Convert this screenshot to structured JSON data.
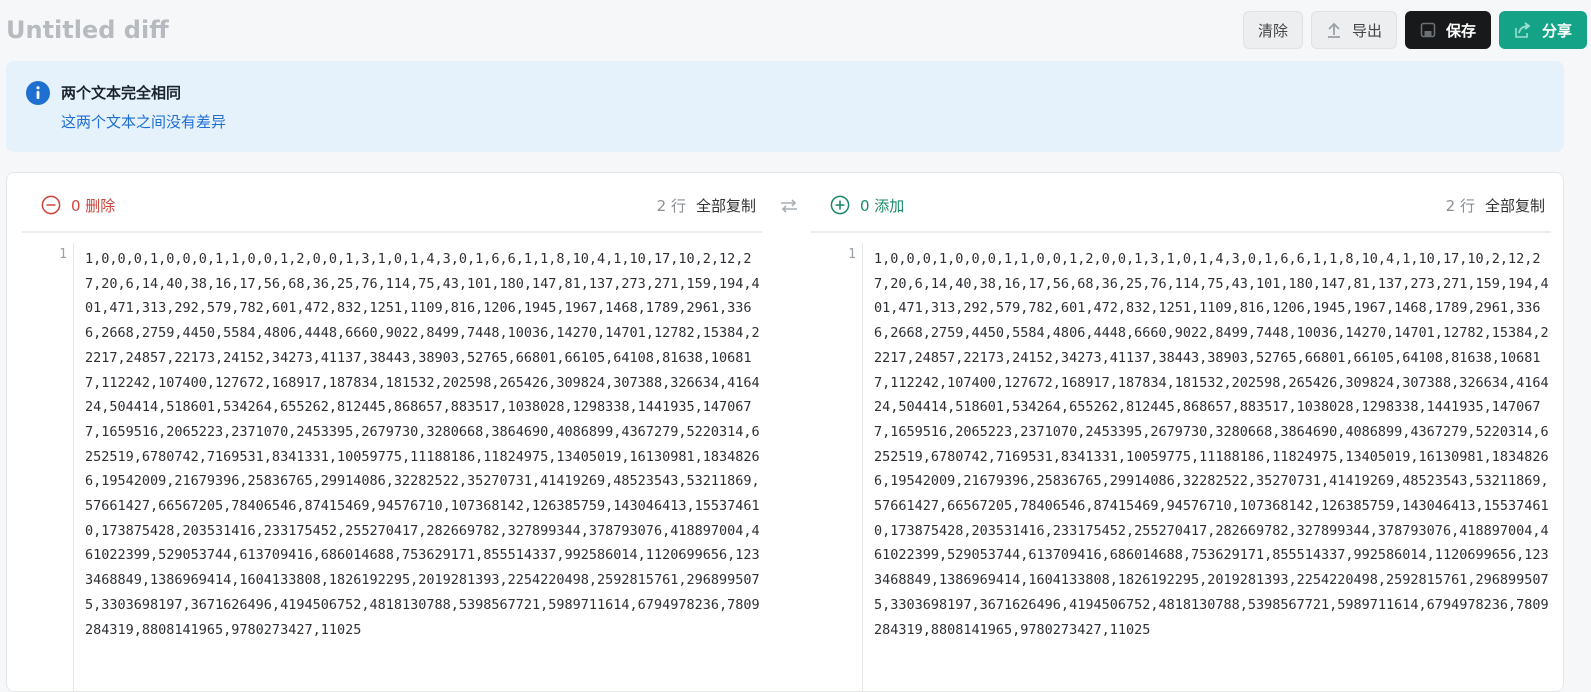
{
  "app": {
    "title": "Untitled diff"
  },
  "toolbar": {
    "clear_label": "清除",
    "export_label": "导出",
    "save_label": "保存",
    "share_label": "分享"
  },
  "alert": {
    "title": "两个文本完全相同",
    "message": "这两个文本之间没有差异",
    "icon": "info-icon"
  },
  "left": {
    "summary": "0 删除",
    "line_count": "2 行",
    "copy_label": "全部复制",
    "line_number": "1",
    "text": "1,0,0,0,1,0,0,0,1,1,0,0,1,2,0,0,1,3,1,0,1,4,3,0,1,6,6,1,1,8,10,4,1,10,17,10,2,12,27,20,6,14,40,38,16,17,56,68,36,25,76,114,75,43,101,180,147,81,137,273,271,159,194,401,471,313,292,579,782,601,472,832,1251,1109,816,1206,1945,1967,1468,1789,2961,3366,2668,2759,4450,5584,4806,4448,6660,9022,8499,7448,10036,14270,14701,12782,15384,22217,24857,22173,24152,34273,41137,38443,38903,52765,66801,66105,64108,81638,106817,112242,107400,127672,168917,187834,181532,202598,265426,309824,307388,326634,416424,504414,518601,534264,655262,812445,868657,883517,1038028,1298338,1441935,1470677,1659516,2065223,2371070,2453395,2679730,3280668,3864690,4086899,4367279,5220314,6252519,6780742,7169531,8341331,10059775,11188186,11824975,13405019,16130981,18348266,19542009,21679396,25836765,29914086,32282522,35270731,41419269,48523543,53211869,57661427,66567205,78406546,87415469,94576710,107368142,126385759,143046413,155374610,173875428,203531416,233175452,255270417,282669782,327899344,378793076,418897004,461022399,529053744,613709416,686014688,753629171,855514337,992586014,1120699656,1233468849,1386969414,1604133808,1826192295,2019281393,2254220498,2592815761,2968995075,3303698197,3671626496,4194506752,4818130788,5398567721,5989711614,6794978236,7809284319,8808141965,9780273427,11025"
  },
  "right": {
    "summary": "0 添加",
    "line_count": "2 行",
    "copy_label": "全部复制",
    "line_number": "1",
    "text": "1,0,0,0,1,0,0,0,1,1,0,0,1,2,0,0,1,3,1,0,1,4,3,0,1,6,6,1,1,8,10,4,1,10,17,10,2,12,27,20,6,14,40,38,16,17,56,68,36,25,76,114,75,43,101,180,147,81,137,273,271,159,194,401,471,313,292,579,782,601,472,832,1251,1109,816,1206,1945,1967,1468,1789,2961,3366,2668,2759,4450,5584,4806,4448,6660,9022,8499,7448,10036,14270,14701,12782,15384,22217,24857,22173,24152,34273,41137,38443,38903,52765,66801,66105,64108,81638,106817,112242,107400,127672,168917,187834,181532,202598,265426,309824,307388,326634,416424,504414,518601,534264,655262,812445,868657,883517,1038028,1298338,1441935,1470677,1659516,2065223,2371070,2453395,2679730,3280668,3864690,4086899,4367279,5220314,6252519,6780742,7169531,8341331,10059775,11188186,11824975,13405019,16130981,18348266,19542009,21679396,25836765,29914086,32282522,35270731,41419269,48523543,53211869,57661427,66567205,78406546,87415469,94576710,107368142,126385759,143046413,155374610,173875428,203531416,233175452,255270417,282669782,327899344,378793076,418897004,461022399,529053744,613709416,686014688,753629171,855514337,992586014,1120699656,1233468849,1386969414,1604133808,1826192295,2019281393,2254220498,2592815761,2968995075,3303698197,3671626496,4194506752,4818130788,5398567721,5989711614,6794978236,7809284319,8808141965,9780273427,11025"
  },
  "colors": {
    "accent_teal": "#14a387",
    "delete_red": "#d0443b",
    "add_green": "#1c8a6a",
    "info_blue": "#1f6fd1",
    "alert_bg": "#e5f2fc"
  }
}
